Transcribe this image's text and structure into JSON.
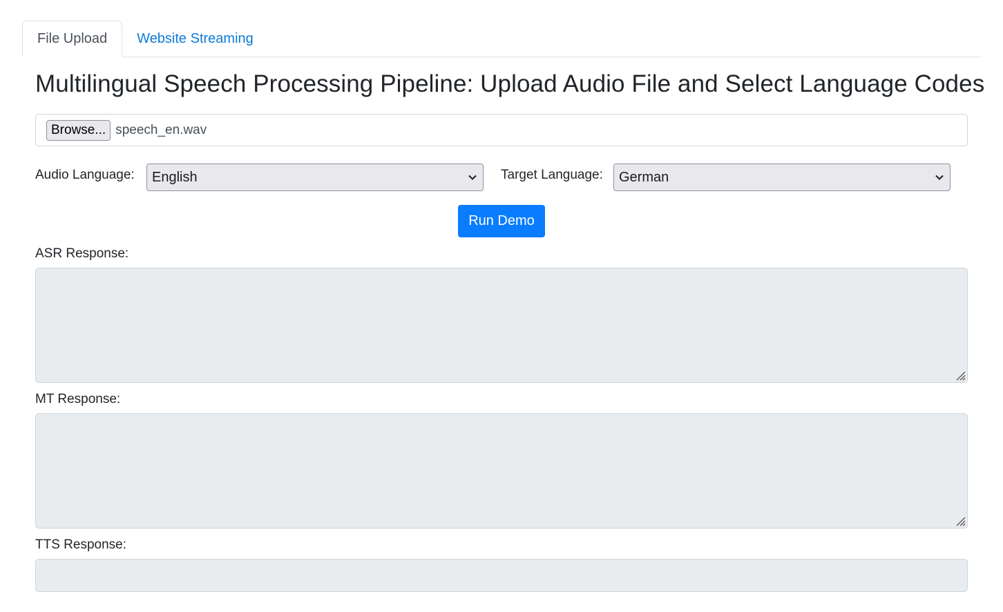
{
  "tabs": [
    {
      "label": "File Upload",
      "active": true
    },
    {
      "label": "Website Streaming",
      "active": false
    }
  ],
  "page_title": "Multilingual Speech Processing Pipeline: Upload Audio File and Select Language Codes",
  "file_input": {
    "button_label": "Browse...",
    "file_name": "speech_en.wav"
  },
  "audio_language": {
    "label": "Audio Language:",
    "selected": "English"
  },
  "target_language": {
    "label": "Target Language:",
    "selected": "German"
  },
  "run_button": {
    "label": "Run Demo"
  },
  "asr": {
    "label": "ASR Response:",
    "value": ""
  },
  "mt": {
    "label": "MT Response:",
    "value": ""
  },
  "tts": {
    "label": "TTS Response:",
    "value": ""
  },
  "colors": {
    "primary": "#0a7cff",
    "link": "#0d7ad9",
    "readonly_bg": "#e9ecef",
    "border": "#ced4da"
  }
}
